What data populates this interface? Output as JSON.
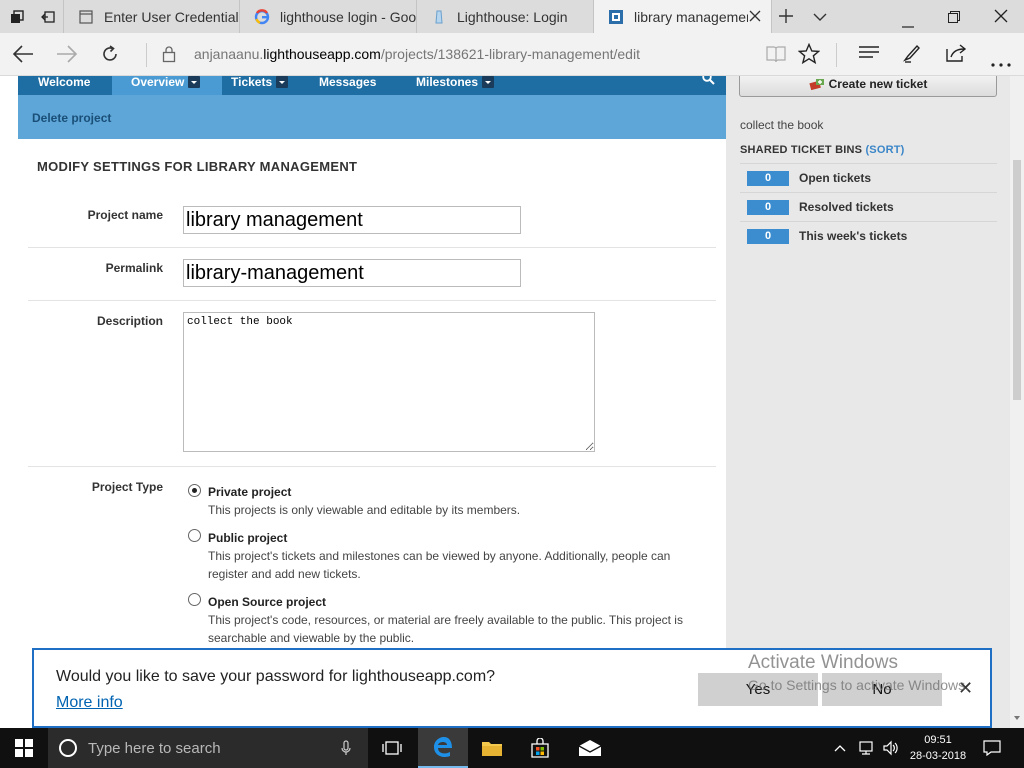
{
  "browser": {
    "tabs": [
      {
        "label": "Enter User Credentials",
        "icon": "page-icon"
      },
      {
        "label": "lighthouse login - Goog",
        "icon": "google-icon"
      },
      {
        "label": "Lighthouse: Login",
        "icon": "lighthouse-icon"
      },
      {
        "label": "library managemen",
        "icon": "lighthouse-icon",
        "active": true
      }
    ],
    "url_prefix": "anjanaanu.",
    "url_domain": "lighthouseapp.com",
    "url_path": "/projects/138621-library-management/edit"
  },
  "nav": {
    "items": [
      {
        "label": "Welcome"
      },
      {
        "label": "Overview",
        "active": true
      },
      {
        "label": "Tickets"
      },
      {
        "label": "Messages"
      },
      {
        "label": "Milestones"
      }
    ],
    "delete_label": "Delete project"
  },
  "form": {
    "heading": "MODIFY SETTINGS FOR LIBRARY MANAGEMENT",
    "project_name_label": "Project name",
    "project_name_value": "library management",
    "permalink_label": "Permalink",
    "permalink_value": "library-management",
    "description_label": "Description",
    "description_value": "collect the book",
    "project_type_label": "Project Type",
    "types": [
      {
        "title": "Private project",
        "desc": "This projects is only viewable and editable by its members.",
        "checked": true
      },
      {
        "title": "Public project",
        "desc": "This project's tickets and milestones can be viewed by anyone. Additionally, people can register and add new tickets.",
        "checked": false
      },
      {
        "title": "Open Source project",
        "desc": "This project's code, resources, or material are freely available to the public. This project is searchable and viewable by the public.",
        "checked": false
      }
    ]
  },
  "sidebar": {
    "new_ticket_label": "Create new ticket",
    "description": "collect the book",
    "bins_heading": "SHARED TICKET BINS",
    "sort_label": "(SORT)",
    "bins": [
      {
        "count": "0",
        "label": "Open tickets"
      },
      {
        "count": "0",
        "label": "Resolved tickets"
      },
      {
        "count": "0",
        "label": "This week's tickets"
      }
    ]
  },
  "password_prompt": {
    "question": "Would you like to save your password for lighthouseapp.com?",
    "more_info": "More info",
    "yes": "Yes",
    "no": "No"
  },
  "watermark": {
    "line1": "Activate Windows",
    "line2": "Go to Settings to activate Windows."
  },
  "taskbar": {
    "search_placeholder": "Type here to search",
    "time": "09:51",
    "date": "28-03-2018"
  }
}
